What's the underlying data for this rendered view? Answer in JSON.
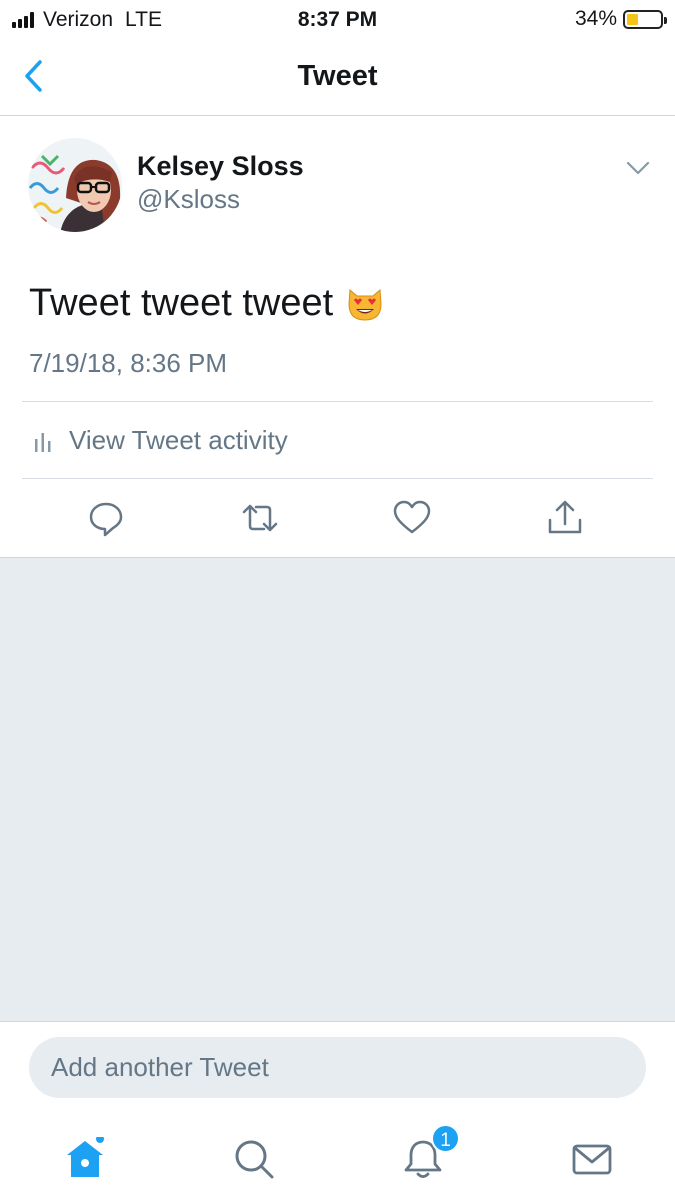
{
  "status_bar": {
    "carrier": "Verizon",
    "network": "LTE",
    "time": "8:37 PM",
    "battery_pct": "34%",
    "battery_level": 0.34,
    "battery_color": "#f5c518"
  },
  "nav": {
    "back_icon": "chevron-left-icon",
    "title": "Tweet"
  },
  "tweet": {
    "author_name": "Kelsey Sloss",
    "author_handle": "@Ksloss",
    "text": "Tweet tweet tweet",
    "emoji": "smiling-cat-heart-eyes",
    "timestamp": "7/19/18, 8:36 PM",
    "activity_label": "View Tweet activity"
  },
  "actions": [
    "reply-icon",
    "retweet-icon",
    "like-icon",
    "share-icon"
  ],
  "composer": {
    "placeholder": "Add another Tweet"
  },
  "tab_bar": {
    "tabs": [
      "home-icon",
      "search-icon",
      "notifications-icon",
      "messages-icon"
    ],
    "notification_count": "1"
  },
  "colors": {
    "accent": "#1da1f2",
    "secondary_text": "#657786",
    "background_gray": "#e6ecf0"
  }
}
